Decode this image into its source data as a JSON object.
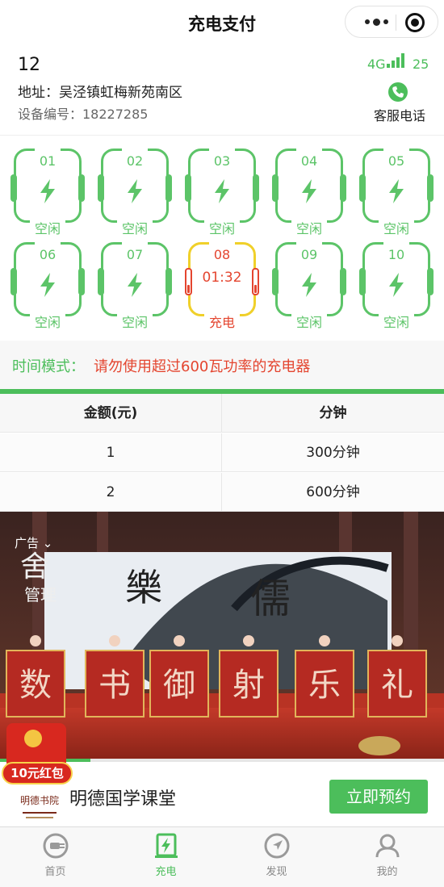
{
  "nav": {
    "title": "充电支付"
  },
  "station": {
    "number": "12",
    "address": "地址：吴泾镇虹梅新苑南区",
    "device": "设备编号：18227285",
    "network": "4G",
    "signal_value": "25",
    "service_label": "客服电话"
  },
  "ports": [
    {
      "num": "01",
      "status": "空闲",
      "state": "idle"
    },
    {
      "num": "02",
      "status": "空闲",
      "state": "idle"
    },
    {
      "num": "03",
      "status": "空闲",
      "state": "idle"
    },
    {
      "num": "04",
      "status": "空闲",
      "state": "idle"
    },
    {
      "num": "05",
      "status": "空闲",
      "state": "idle"
    },
    {
      "num": "06",
      "status": "空闲",
      "state": "idle"
    },
    {
      "num": "07",
      "status": "空闲",
      "state": "idle"
    },
    {
      "num": "08",
      "status": "充电",
      "state": "charging",
      "timer": "01:32"
    },
    {
      "num": "09",
      "status": "空闲",
      "state": "idle"
    },
    {
      "num": "10",
      "status": "空闲",
      "state": "idle"
    }
  ],
  "mode": {
    "label": "时间模式：",
    "warning": "请勿使用超过600瓦功率的充电器"
  },
  "price_table": {
    "headers": [
      "金额(元)",
      "分钟"
    ],
    "rows": [
      [
        "1",
        "300分钟"
      ],
      [
        "2",
        "600分钟"
      ]
    ]
  },
  "ad": {
    "label": "广告",
    "video_chars": [
      "数",
      "书",
      "御",
      "射",
      "乐",
      "礼"
    ],
    "logo_text": "明德书院",
    "redpack": "10元红包",
    "name": "明德国学课堂",
    "cta": "立即预约"
  },
  "tabs": [
    {
      "label": "首页",
      "icon": "home-plug-icon"
    },
    {
      "label": "充电",
      "icon": "charge-icon",
      "active": true
    },
    {
      "label": "发现",
      "icon": "compass-icon"
    },
    {
      "label": "我的",
      "icon": "user-icon"
    }
  ],
  "colors": {
    "accent": "#4cbe5b",
    "warning": "#e4452f",
    "charging_frame": "#f0d02a"
  }
}
